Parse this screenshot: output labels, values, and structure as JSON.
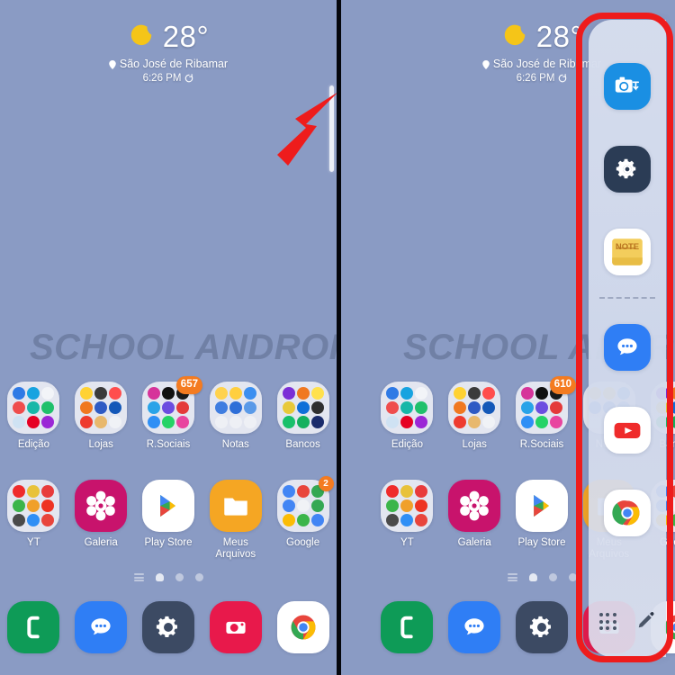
{
  "wallpaper_color": "#8a9bc4",
  "watermark": "SCHOOL ANDROID BR",
  "annotation": {
    "arrow_color": "#ee1c1c",
    "box_color": "#ee1c1c",
    "handle_name": "edge-panel-handle"
  },
  "weather": {
    "icon": "crescent-moon-icon",
    "temperature": "28°",
    "location": "São José de Ribamar",
    "location_icon": "location-pin-icon",
    "time": "6:26 PM",
    "refresh_icon": "refresh-icon"
  },
  "home": {
    "row1": [
      {
        "label": "Edição",
        "type": "folder",
        "badge": null,
        "colors": [
          "#2f7ae5",
          "#17a3e0",
          "#f2f4f8",
          "#ef4d4d",
          "#17b7a8",
          "#1fc06b",
          "#cfe2f3",
          "#e60023",
          "#9b27d6"
        ]
      },
      {
        "label": "Lojas",
        "type": "folder",
        "badge": null,
        "colors": [
          "#ffd233",
          "#3b3b3b",
          "#ff4d4d",
          "#f07820",
          "#2e5ac4",
          "#1458b8",
          "#ee3b2f",
          "#e8b86d",
          "#f0f2f6"
        ]
      },
      {
        "label": "R.Sociais",
        "type": "folder",
        "badge": "657",
        "colors": [
          "#d6339a",
          "#111111",
          "#1b1b1b",
          "#29a3e8",
          "#6b4de0",
          "#e43a3a",
          "#2f8ff5",
          "#25d366",
          "#e8459f"
        ]
      },
      {
        "label": "Notas",
        "type": "folder",
        "badge": null,
        "colors": [
          "#ffd24d",
          "#ffcf3f",
          "#3b8ff0",
          "#3f7de0",
          "#2f6fd8",
          "#5a9ae8",
          "#eef0f5",
          "#eef0f5",
          "#eef0f5"
        ]
      },
      {
        "label": "Bancos",
        "type": "folder",
        "badge": null,
        "colors": [
          "#7b2fd6",
          "#f07820",
          "#ffe14d",
          "#e8c93a",
          "#0f6fd8",
          "#2f2f2f",
          "#18c06b",
          "#13b05e",
          "#1a2b6b"
        ]
      }
    ],
    "row2": [
      {
        "label": "YT",
        "type": "folder",
        "badge": null,
        "colors": [
          "#ef2b2b",
          "#e8c23a",
          "#e83b3b",
          "#3bb54a",
          "#f0a02a",
          "#ee3322",
          "#4a4a4a",
          "#2f8ff5",
          "#e8453c"
        ]
      },
      {
        "label": "Galeria",
        "type": "app",
        "badge": null,
        "icon": "gallery-flower-icon"
      },
      {
        "label": "Play Store",
        "type": "app",
        "badge": null,
        "icon": "play-store-icon"
      },
      {
        "label": "Meus\nArquivos",
        "type": "app",
        "badge": null,
        "icon": "my-files-folder-icon"
      },
      {
        "label": "Google",
        "type": "folder",
        "badge": "2",
        "colors": [
          "#4285f4",
          "#e8453c",
          "#34a853",
          "#4285f4",
          "#f0f2f6",
          "#34a853",
          "#fbbc05",
          "#3bb54a",
          "#4285f4"
        ]
      }
    ],
    "page_indicators": [
      "apps-list-icon",
      "home-page-dot",
      "page-dot",
      "page-dot"
    ],
    "dock": [
      {
        "label": "Phone",
        "icon": "phone-icon",
        "bg": "#0e9b57"
      },
      {
        "label": "Messages",
        "icon": "messages-icon",
        "bg": "#2f7ef5"
      },
      {
        "label": "Settings",
        "icon": "settings-gear-icon",
        "bg": "#3c4a63"
      },
      {
        "label": "Camera",
        "icon": "camera-icon",
        "bg": "#e8194b"
      },
      {
        "label": "Chrome",
        "icon": "chrome-icon",
        "bg": "#ffffff"
      }
    ]
  },
  "home_right": {
    "row1_badge": "610"
  },
  "edge_panel": {
    "items": [
      {
        "name": "smart-select-screenshot-icon",
        "label": "Captura de tela"
      },
      {
        "name": "settings-gear-icon",
        "label": "Configurações"
      },
      {
        "name": "note-icon",
        "label": "Note"
      },
      {
        "name": "messages-icon",
        "label": "Mensagens"
      },
      {
        "name": "youtube-icon",
        "label": "YouTube"
      },
      {
        "name": "chrome-icon",
        "label": "Chrome"
      }
    ],
    "bottom": [
      {
        "name": "all-apps-grid-icon",
        "label": "Apps"
      },
      {
        "name": "edit-pencil-icon",
        "label": "Editar"
      }
    ]
  }
}
